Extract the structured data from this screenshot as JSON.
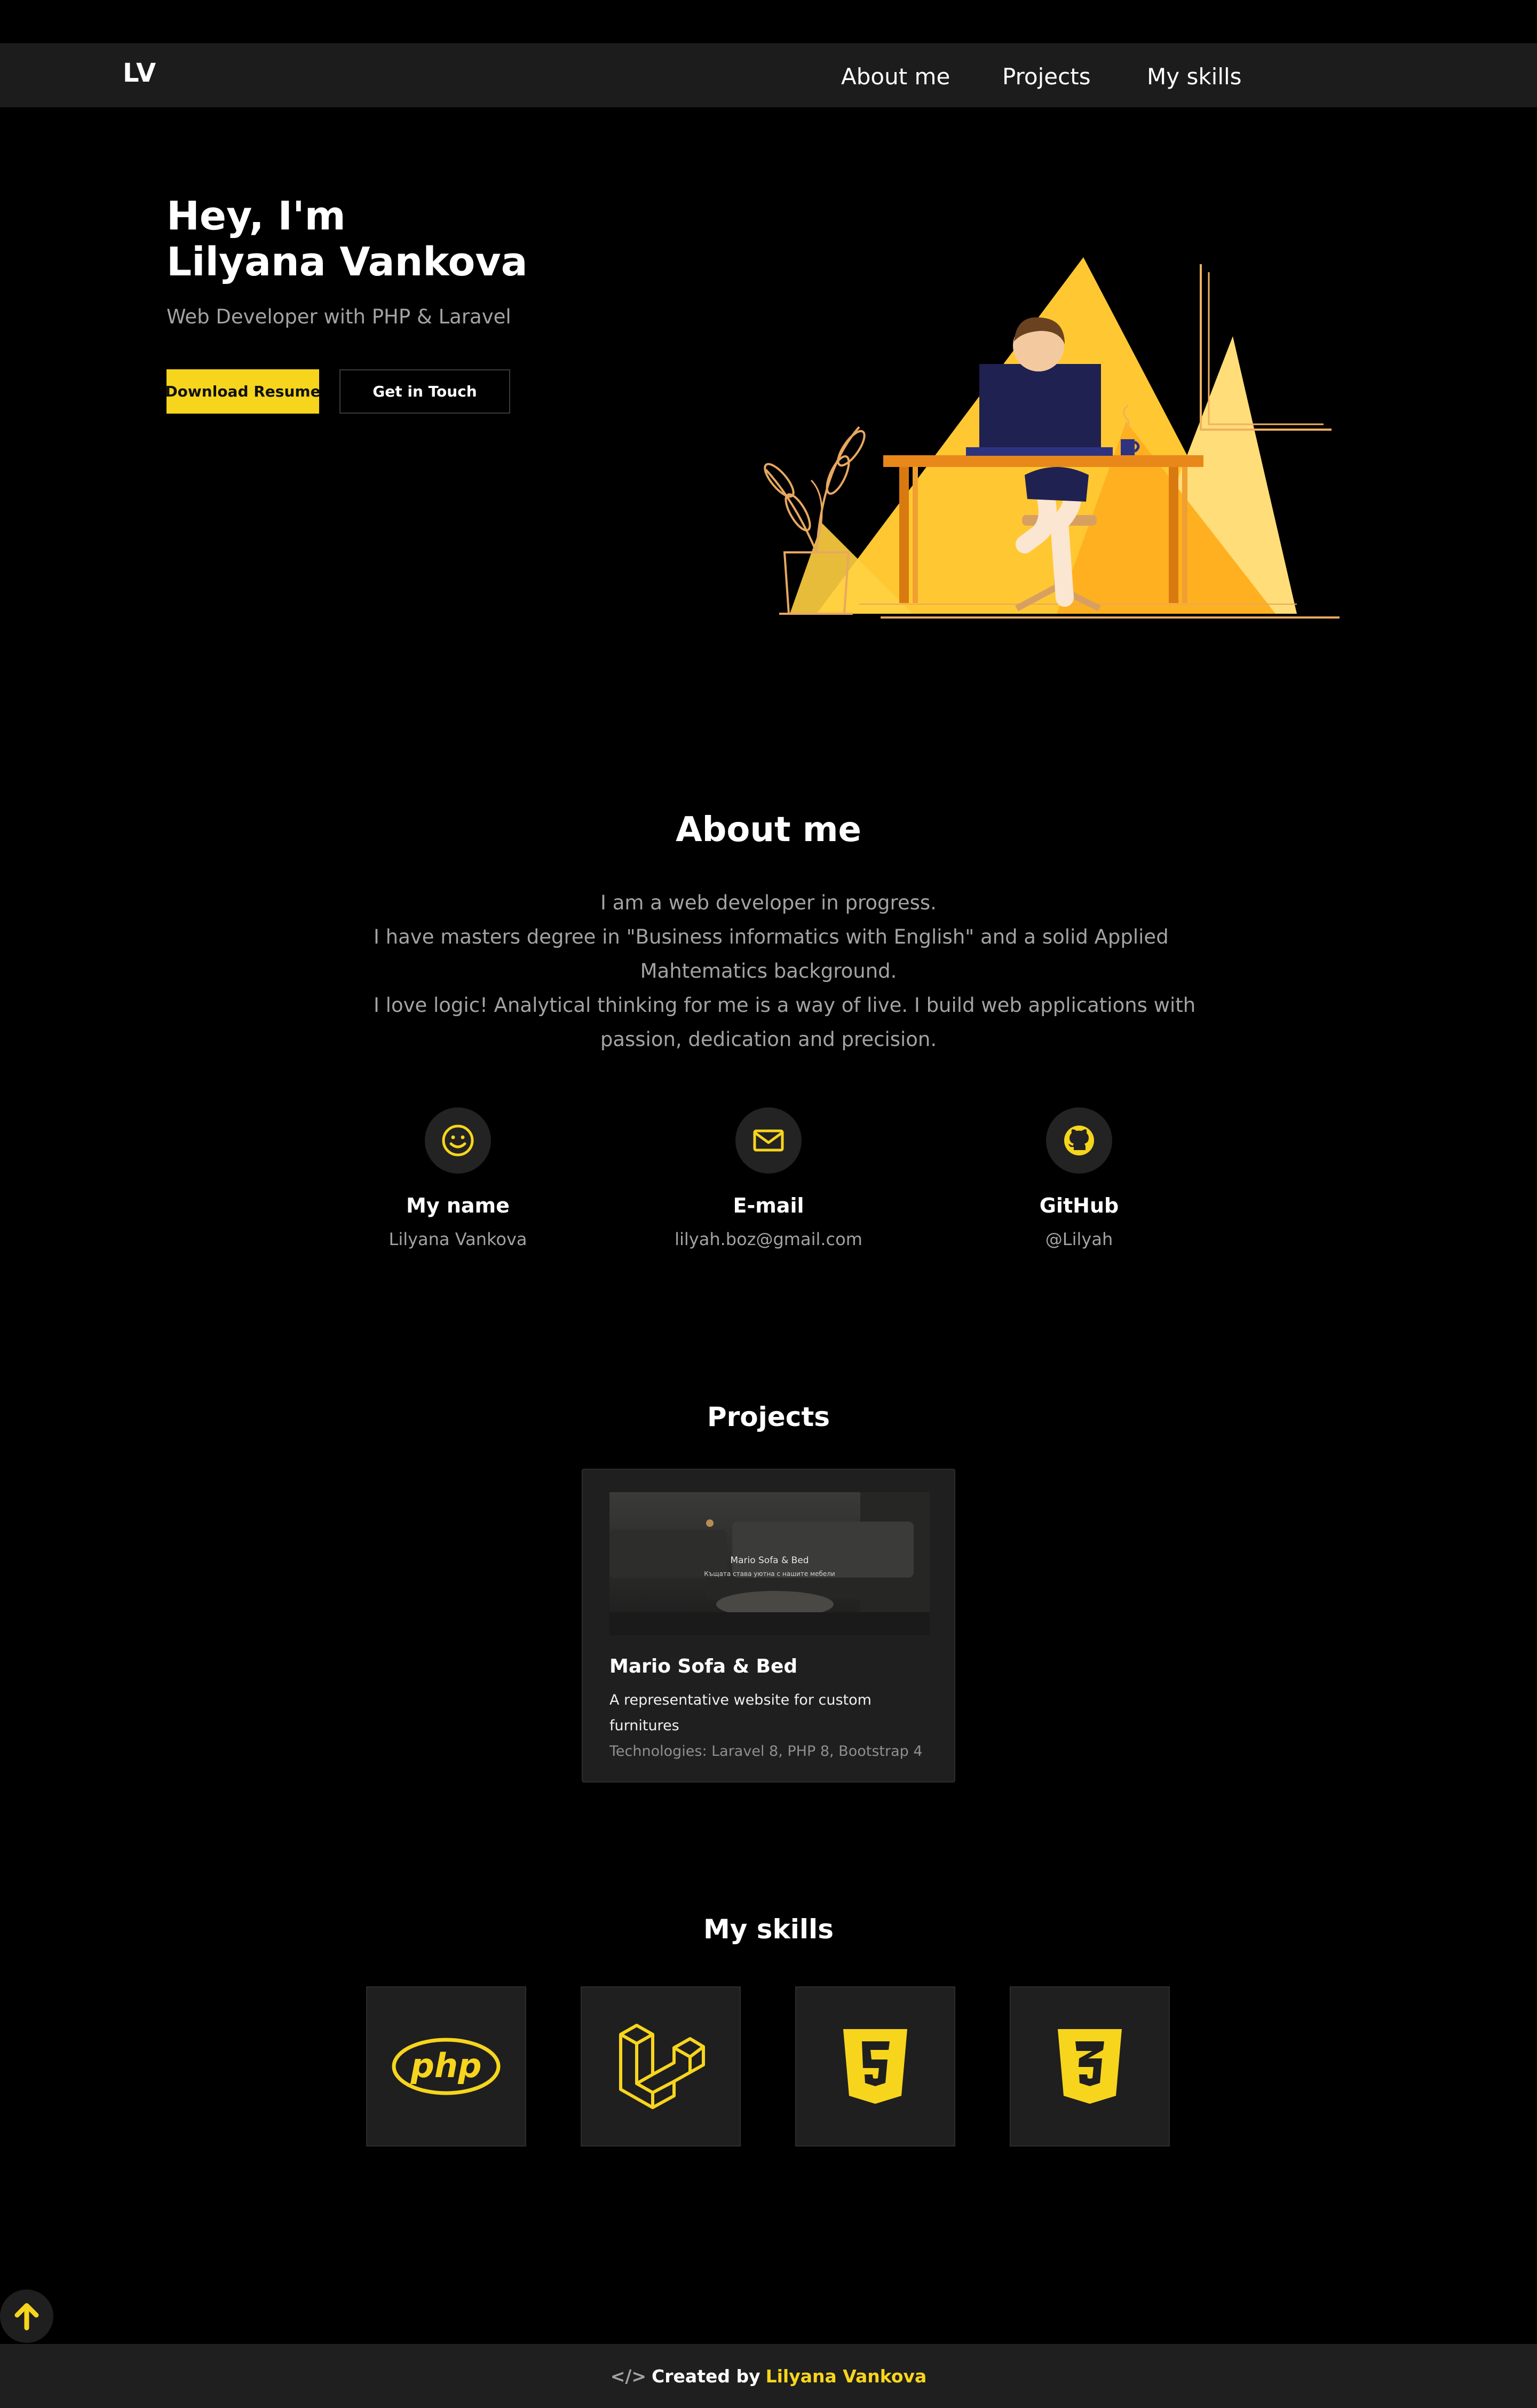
{
  "colors": {
    "accent": "#f7d51d",
    "background": "#000000",
    "surface": "#1f1f1f",
    "muted": "#a3a3a3"
  },
  "nav": {
    "logo": "LV",
    "links": [
      "About me",
      "Projects",
      "My skills"
    ]
  },
  "hero": {
    "greeting": "Hey, I'm",
    "name": "Lilyana Vankova",
    "subtitle": "Web Developer with PHP & Laravel",
    "primary_button": "Download Resume",
    "secondary_button": "Get in Touch"
  },
  "about": {
    "title": "About me",
    "lines": [
      "I am a web developer in progress.",
      "I have masters degree in \"Business informatics with English\" and a solid Applied",
      "Mahtematics background.",
      "I love logic! Analytical thinking for me is a way of live. I build web applications with",
      "passion, dedication and precision."
    ],
    "contacts": [
      {
        "icon": "smile-icon",
        "label": "My name",
        "value": "Lilyana Vankova"
      },
      {
        "icon": "envelope-icon",
        "label": "E-mail",
        "value": "lilyah.boz@gmail.com"
      },
      {
        "icon": "github-icon",
        "label": "GitHub",
        "value": "@Lilyah"
      }
    ]
  },
  "projects": {
    "title": "Projects",
    "items": [
      {
        "image_title": "Mario Sofa & Bed",
        "image_subtitle": "Къщата става уютна с нашите мебели",
        "title": "Mario Sofa & Bed",
        "description": "A representative website for custom furnitures",
        "technologies": "Technologies: Laravel 8, PHP 8, Bootstrap 4"
      }
    ]
  },
  "skills": {
    "title": "My skills",
    "items": [
      "php-icon",
      "laravel-icon",
      "html5-icon",
      "css3-icon"
    ]
  },
  "footer": {
    "prefix": "Created by",
    "author": "Lilyana Vankova"
  }
}
